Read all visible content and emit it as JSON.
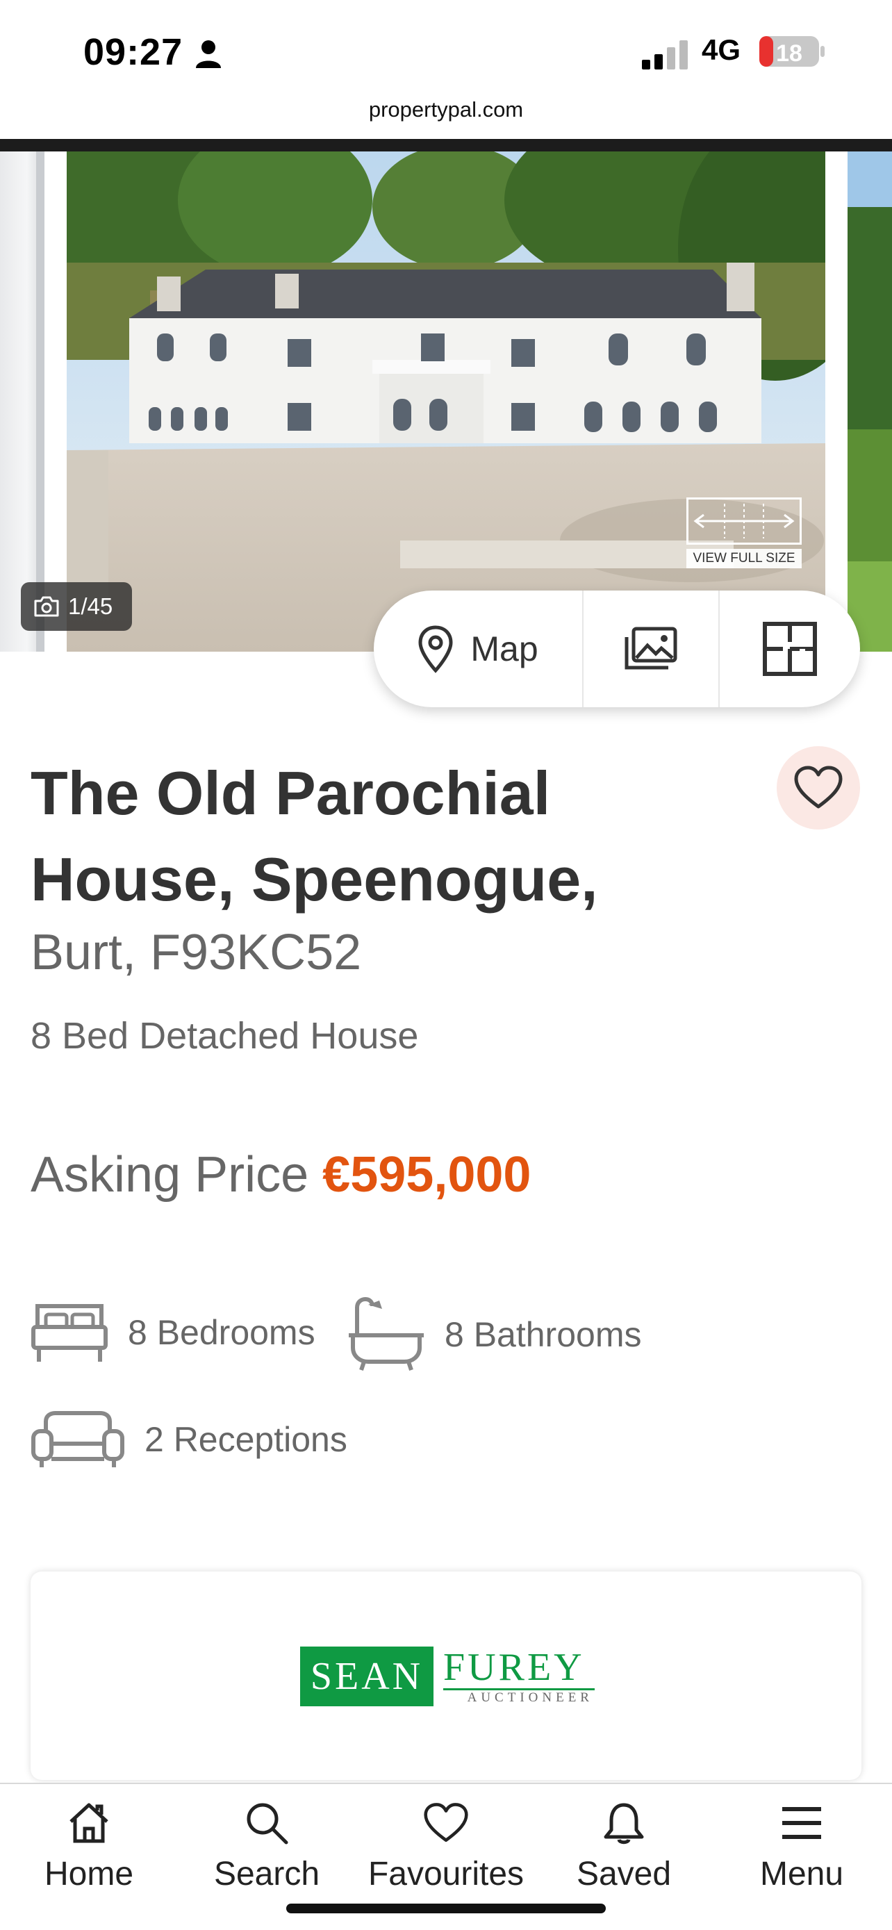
{
  "status_bar": {
    "time": "09:27",
    "network": "4G",
    "battery": "18"
  },
  "browser": {
    "url": "propertypal.com"
  },
  "gallery": {
    "counter": "1/45",
    "view_full_label": "VIEW FULL SIZE",
    "map_label": "Map"
  },
  "listing": {
    "title": "The Old Parochial House, Speenogue,",
    "subtitle": "Burt, F93KC52",
    "type": "8 Bed Detached House",
    "price_label": "Asking Price",
    "price_value": "€595,000",
    "features": {
      "bedrooms": "8 Bedrooms",
      "bathrooms": "8 Bathrooms",
      "receptions": "2 Receptions"
    }
  },
  "agent": {
    "logo_left": "SEAN",
    "logo_right": "FUREY",
    "logo_sub": "AUCTIONEER"
  },
  "nav": {
    "home": "Home",
    "search": "Search",
    "favourites": "Favourites",
    "saved": "Saved",
    "menu": "Menu"
  },
  "colors": {
    "price": "#e2540f",
    "favourite_bg": "#fbe8e4",
    "agent_green": "#0f9a43"
  }
}
